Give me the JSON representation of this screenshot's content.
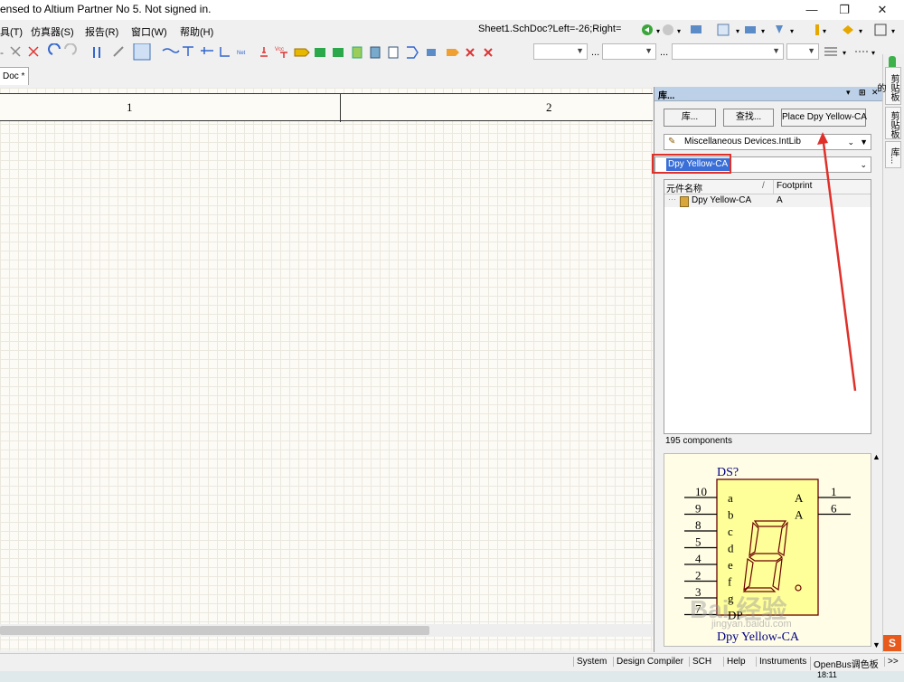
{
  "window": {
    "title": "ensed to Altium Partner No 5. Not signed in.",
    "buttons": [
      "—",
      "❐",
      "✕"
    ]
  },
  "menu": {
    "items": [
      "具(T)",
      "仿真器(S)",
      "报告(R)",
      "窗口(W)",
      "帮助(H)"
    ],
    "doc_path": "Sheet1.SchDoc?Left=-26;Right="
  },
  "toolbar": {
    "dots1": "...",
    "dots2": "..."
  },
  "doc_tab": {
    "label": "Doc *"
  },
  "sheet": {
    "zone_labels": [
      "1",
      "2"
    ]
  },
  "library_panel": {
    "title": "库...",
    "title_icons": [
      "▾",
      "⊞",
      "✕"
    ],
    "buttons": {
      "library": "库...",
      "search": "查找...",
      "place": "Place Dpy Yellow-CA"
    },
    "library_selected": "Miscellaneous Devices.IntLib",
    "filter_value": "Dpy Yellow-CA",
    "columns": {
      "name": "元件名称",
      "footprint": "Footprint",
      "sort": "/"
    },
    "rows": [
      {
        "name": "Dpy Yellow-CA",
        "footprint": "A"
      }
    ],
    "count_text": "195 components",
    "preview": {
      "designator": "DS?",
      "left_pins": [
        "10",
        "9",
        "8",
        "5",
        "4",
        "2",
        "3",
        "7"
      ],
      "pin_names": [
        "a",
        "b",
        "c",
        "d",
        "e",
        "f",
        "g",
        "DP"
      ],
      "right_pins": [
        "1",
        "6"
      ],
      "right_names": [
        "A",
        "A"
      ],
      "part_name": "Dpy Yellow-CA",
      "digit": "8."
    },
    "colors": {
      "highlight": "#3a6fd8",
      "annotation": "#e0302a",
      "preview_bg": "#fffde6",
      "symbol_fill": "#ffff99",
      "pin_text": "#000080"
    }
  },
  "right_tabs": [
    "剪贴板的",
    "剪贴板",
    "库..."
  ],
  "status_bar": {
    "items": [
      "System",
      "Design Compiler",
      "SCH",
      "Help",
      "Instruments",
      "OpenBus调色板",
      ">>"
    ]
  },
  "taskbar": {
    "time": "18:11"
  },
  "watermark": {
    "text": "Bai 经验",
    "url": "jingyan.baidu.com"
  }
}
